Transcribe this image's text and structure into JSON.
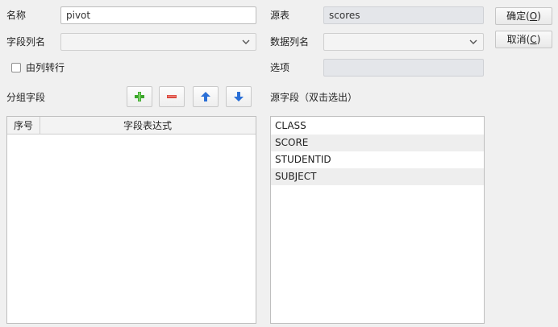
{
  "form": {
    "name_label": "名称",
    "name_value": "pivot",
    "field_column_label": "字段列名",
    "field_column_value": "",
    "row_from_column_label": "由列转行",
    "group_fields_label": "分组字段",
    "source_table_label": "源表",
    "source_table_value": "scores",
    "data_column_label": "数据列名",
    "data_column_value": "",
    "options_label": "选项",
    "options_value": "",
    "source_fields_label": "源字段（双击选出）"
  },
  "buttons": {
    "ok_label": "确定(",
    "ok_key": "O",
    "ok_tail": ")",
    "cancel_label": "取消(",
    "cancel_key": "C",
    "cancel_tail": ")"
  },
  "group_table": {
    "columns": [
      "序号",
      "字段表达式"
    ],
    "rows": []
  },
  "source_fields": [
    "CLASS",
    "SCORE",
    "STUDENTID",
    "SUBJECT"
  ],
  "colors": {
    "add": "#3aa52a",
    "remove": "#d9443a",
    "arrow": "#2a6fd6"
  }
}
